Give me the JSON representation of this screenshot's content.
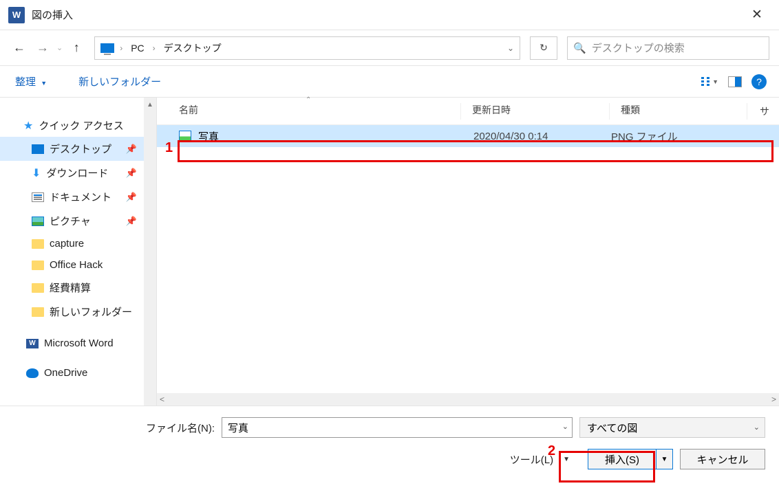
{
  "titlebar": {
    "title": "図の挿入"
  },
  "nav": {
    "crumbs": [
      "PC",
      "デスクトップ"
    ],
    "search_placeholder": "デスクトップの検索"
  },
  "toolbar": {
    "organize": "整理",
    "newfolder": "新しいフォルダー"
  },
  "sidebar": {
    "quick_access": "クイック アクセス",
    "items": [
      {
        "label": "デスクトップ",
        "pinned": true,
        "icon": "desktop"
      },
      {
        "label": "ダウンロード",
        "pinned": true,
        "icon": "download"
      },
      {
        "label": "ドキュメント",
        "pinned": true,
        "icon": "doc"
      },
      {
        "label": "ピクチャ",
        "pinned": true,
        "icon": "pic"
      },
      {
        "label": "capture",
        "pinned": false,
        "icon": "folder"
      },
      {
        "label": "Office Hack",
        "pinned": false,
        "icon": "folder"
      },
      {
        "label": "経費精算",
        "pinned": false,
        "icon": "folder"
      },
      {
        "label": "新しいフォルダー",
        "pinned": false,
        "icon": "folder"
      }
    ],
    "microsoft_word": "Microsoft Word",
    "onedrive": "OneDrive"
  },
  "columns": {
    "name": "名前",
    "date": "更新日時",
    "type": "種類",
    "size": "サ"
  },
  "file": {
    "name": "写真",
    "date": "2020/04/30 0:14",
    "type": "PNG ファイル"
  },
  "bottom": {
    "filename_label": "ファイル名(N):",
    "filename_value": "写真",
    "filter": "すべての図",
    "tools": "ツール(L)",
    "insert": "挿入(S)",
    "cancel": "キャンセル"
  },
  "annotations": {
    "n1": "1",
    "n2": "2"
  }
}
